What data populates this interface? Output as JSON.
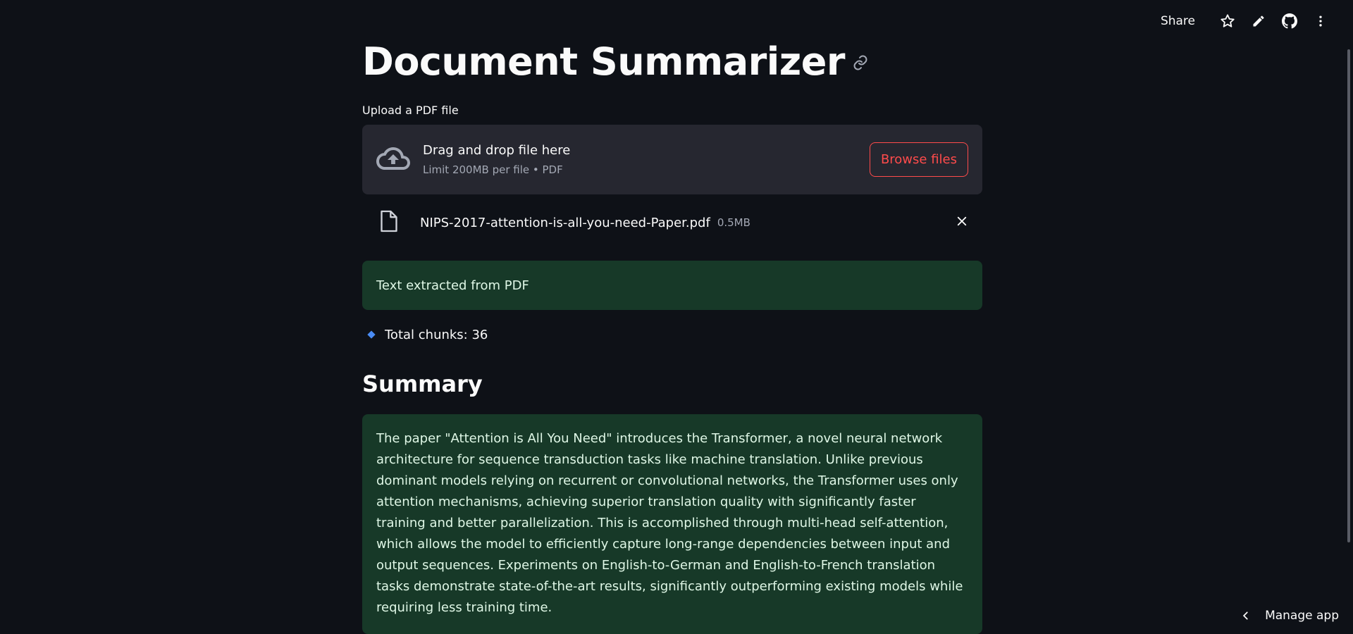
{
  "topbar": {
    "share_label": "Share",
    "icons": [
      "star-icon",
      "pencil-icon",
      "github-icon",
      "more-vertical-icon"
    ]
  },
  "page": {
    "title": "Document Summarizer"
  },
  "uploader": {
    "label": "Upload a PDF file",
    "drop_text": "Drag and drop file here",
    "limit_text": "Limit 200MB per file • PDF",
    "browse_label": "Browse files"
  },
  "file": {
    "name": "NIPS-2017-attention-is-all-you-need-Paper.pdf",
    "size": "0.5MB"
  },
  "status": {
    "success_text": "Text extracted from PDF",
    "chunks_text": "Total chunks: 36"
  },
  "summary": {
    "heading": "Summary",
    "text": "The paper \"Attention is All You Need\" introduces the Transformer, a novel neural network architecture for sequence transduction tasks like machine translation. Unlike previous dominant models relying on recurrent or convolutional networks, the Transformer uses only attention mechanisms, achieving superior translation quality with significantly faster training and better parallelization. This is accomplished through multi-head self-attention, which allows the model to efficiently capture long-range dependencies between input and output sequences. Experiments on English-to-German and English-to-French translation tasks demonstrate state-of-the-art results, significantly outperforming existing models while requiring less training time."
  },
  "footer": {
    "manage_label": "Manage app"
  },
  "colors": {
    "background": "#0e1117",
    "accent": "#ff4b4b",
    "success_bg": "#173928",
    "dropzone_bg": "#262730",
    "bullet": "#4a8cf5"
  }
}
